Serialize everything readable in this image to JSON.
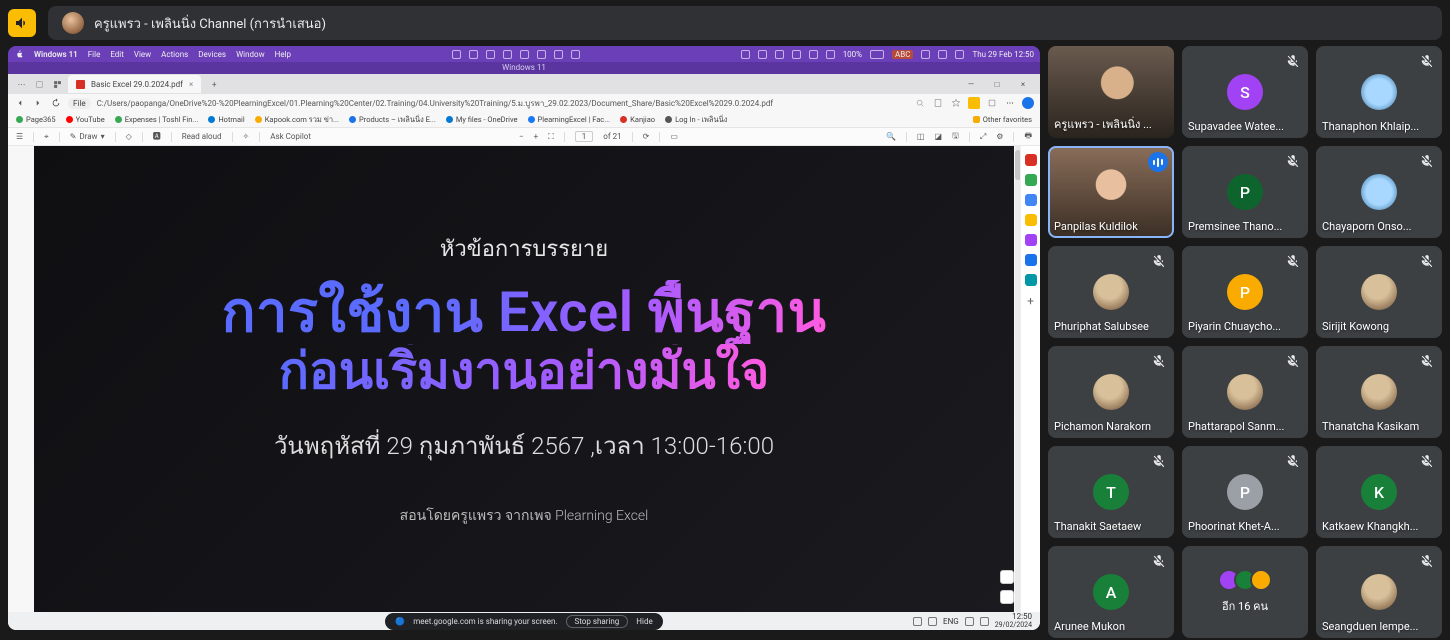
{
  "header": {
    "room_title": "ครูแพรว - เพลินนิ่ง Channel (การนำเสนอ)"
  },
  "mac_menu": {
    "items": [
      "Windows 11",
      "File",
      "Edit",
      "View",
      "Actions",
      "Devices",
      "Window",
      "Help"
    ],
    "clock": "Thu 29 Feb 12:50",
    "zoom": "100%",
    "indicator": "ABC"
  },
  "win_title": "Windows 11",
  "browser": {
    "tab_title": "Basic Excel 29.0.2024.pdf",
    "url_prefix": "File",
    "url": "C:/Users/paopanga/OneDrive%20-%20PlearningExcel/01.Plearning%20Center/02.Training/04.University%20Training/5.ม.บูรพา_29.02.2023/Document_Share/Basic%20Excel%2029.0.2024.pdf",
    "bookmarks": [
      "Page365",
      "YouTube",
      "Expenses | Toshl Fin...",
      "Hotmail",
      "Kapook.com รวม ข่า...",
      "Products – เพลินนิ่ง E...",
      "My files - OneDrive",
      "PlearningExcel | Fac...",
      "Kanjiao",
      "Log In - เพลินนิ่ง"
    ],
    "other_fav": "Other favorites"
  },
  "pdf_toolbar": {
    "draw": "Draw",
    "read": "Read aloud",
    "copilot": "Ask Copilot",
    "page": "1",
    "page_of": "of 21"
  },
  "slide": {
    "line1": "หัวข้อการบรรยาย",
    "line2": "การใช้งาน Excel พื้นฐาน",
    "line3": "ก่อนเริ่มงานอย่างมั่นใจ",
    "line4": "วันพฤหัสที่ 29 กุมภาพันธ์ 2567 ,เวลา 13:00-16:00",
    "line5": "สอนโดยครูแพรว จากเพจ Plearning Excel"
  },
  "sharebar": {
    "msg": "meet.google.com is sharing your screen.",
    "stop": "Stop sharing",
    "hide": "Hide"
  },
  "taskbar": {
    "lang": "ENG",
    "time": "12:50",
    "date": "29/02/2024"
  },
  "participants": [
    {
      "name": "ครูแพรว - เพลินนิ่ง ...",
      "type": "video",
      "muted": false,
      "speaking": false,
      "vid": 1
    },
    {
      "name": "Supavadee Watee...",
      "type": "letter",
      "letter": "S",
      "color": "#a142f4",
      "muted": true
    },
    {
      "name": "Thanaphon Khlaip...",
      "type": "icon",
      "muted": true
    },
    {
      "name": "Panpilas Kuldilok",
      "type": "video",
      "muted": false,
      "speaking": true,
      "active": true,
      "vid": 2
    },
    {
      "name": "Premsinee Thano...",
      "type": "letter",
      "letter": "P",
      "color": "#0d652d",
      "muted": true
    },
    {
      "name": "Chayaporn Onso...",
      "type": "icon",
      "muted": true
    },
    {
      "name": "Phuriphat Salubsee",
      "type": "img",
      "muted": true
    },
    {
      "name": "Piyarin Chuaycho...",
      "type": "letter",
      "letter": "P",
      "color": "#f9ab00",
      "muted": true
    },
    {
      "name": "Sirijit Kowong",
      "type": "img",
      "muted": true
    },
    {
      "name": "Pichamon Narakorn",
      "type": "img",
      "muted": true
    },
    {
      "name": "Phattarapol Sanm...",
      "type": "img",
      "muted": true
    },
    {
      "name": "Thanatcha Kasikam",
      "type": "img",
      "muted": true
    },
    {
      "name": "Thanakit Saetaew",
      "type": "letter",
      "letter": "T",
      "color": "#188038",
      "muted": true
    },
    {
      "name": "Phoorinat Khet-A...",
      "type": "letter",
      "letter": "P",
      "color": "#9aa0a6",
      "muted": true
    },
    {
      "name": "Katkaew Khangkh...",
      "type": "letter",
      "letter": "K",
      "color": "#188038",
      "muted": true
    },
    {
      "name": "Arunee Mukon",
      "type": "letter",
      "letter": "A",
      "color": "#188038",
      "muted": true
    },
    {
      "name": "อีก 16 คน",
      "type": "overflow"
    },
    {
      "name": "Seangduen lempe...",
      "type": "img",
      "muted": true
    }
  ]
}
